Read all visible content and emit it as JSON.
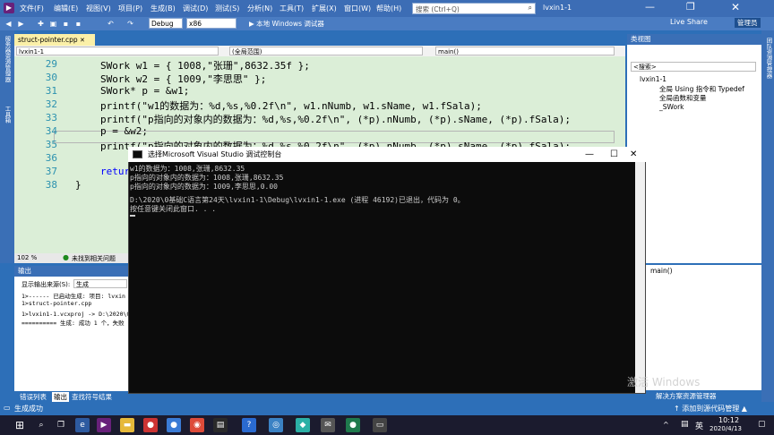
{
  "menu": {
    "items": [
      "文件(F)",
      "编辑(E)",
      "视图(V)",
      "项目(P)",
      "生成(B)",
      "调试(D)",
      "测试(S)",
      "分析(N)",
      "工具(T)",
      "扩展(X)",
      "窗口(W)",
      "帮助(H)"
    ],
    "search_placeholder": "搜索 (Ctrl+Q)",
    "project_title": "lvxin1-1",
    "liveshare": "Live Share",
    "admin": "管理员"
  },
  "toolbar": {
    "config": "Debug",
    "platform": "x86",
    "run_label": "▶ 本地 Windows 调试器"
  },
  "left_strip": {
    "items": [
      "服务器资源管理器",
      "工具箱"
    ]
  },
  "doc_tab": {
    "label": "struct-pointer.cpp"
  },
  "nav": {
    "project": "lvxin1-1",
    "scope": "(全局范围)",
    "func": "main()"
  },
  "editor": {
    "lines": [
      {
        "n": "29",
        "code": "SWork w1 = { 1008,\"张珊\",8632.35f };"
      },
      {
        "n": "30",
        "code": "SWork w2 = { 1009,\"李思思\" };"
      },
      {
        "n": "31",
        "code": "SWork* p = &w1;"
      },
      {
        "n": "32",
        "code": "printf(\"w1的数据为：%d,%s,%0.2f\\n\", w1.nNumb, w1.sName, w1.fSala);"
      },
      {
        "n": "33",
        "code": "printf(\"p指向的对象内的数据为：%d,%s,%0.2f\\n\", (*p).nNumb, (*p).sName, (*p).fSala);"
      },
      {
        "n": "34",
        "code": "p = &w2;"
      },
      {
        "n": "35",
        "code": "printf(\"p指向的对象内的数据为：%d,%s,%0.2f\\n\", (*p).nNumb, (*p).sName, (*p).fSala);"
      },
      {
        "n": "36",
        "code": ""
      },
      {
        "n": "37",
        "code": "return"
      },
      {
        "n": "38",
        "code": "}"
      }
    ],
    "zoom": "102 %",
    "issues": "未找到相关问题"
  },
  "class_view": {
    "header": "类视图",
    "search_placeholder": "<搜索>",
    "items": [
      "lvxin1-1",
      "全局 Using 指令和 Typedef",
      "全局函数和变量",
      "_SWork"
    ],
    "member": "main()"
  },
  "right_strip": {
    "items": [
      "团队资源管理器"
    ]
  },
  "output": {
    "header": "输出",
    "source_label": "显示输出来源(S):",
    "source_value": "生成",
    "lines": [
      "1>------ 已启动生成: 项目: lvxin",
      "1>struct-pointer.cpp",
      "1>lvxin1-1.vcxproj -> D:\\2020\\0基",
      "========== 生成: 成功 1 个，失败"
    ]
  },
  "bottom_tabs": [
    "错误列表",
    "输出",
    "查找符号结果"
  ],
  "right_bottom_tab": "解决方案资源管理器",
  "status": {
    "left": "生成成功",
    "right": "↑ 添加到源代码管理 ▲"
  },
  "console": {
    "title": "选择Microsoft Visual Studio 调试控制台",
    "lines": [
      "w1的数据为：1008,张珊,8632.35",
      "p指向的对象内的数据为：1008,张珊,8632.35",
      "p指向的对象内的数据为：1009,李思思,0.00",
      "",
      "D:\\2020\\0基础C语言第24天\\lvxin1-1\\Debug\\lvxin1-1.exe (进程 46192)已退出，代码为 0。",
      "按任意键关闭此窗口. . ."
    ]
  },
  "watermark": "激活 Windows",
  "taskbar": {
    "time": "10:12",
    "date": "2020/4/13",
    "lang": "英"
  },
  "colors": {
    "vs_blue": "#2d6fb8",
    "editor_bg": "#dbeed7",
    "console_bg": "#0c0c0c"
  }
}
